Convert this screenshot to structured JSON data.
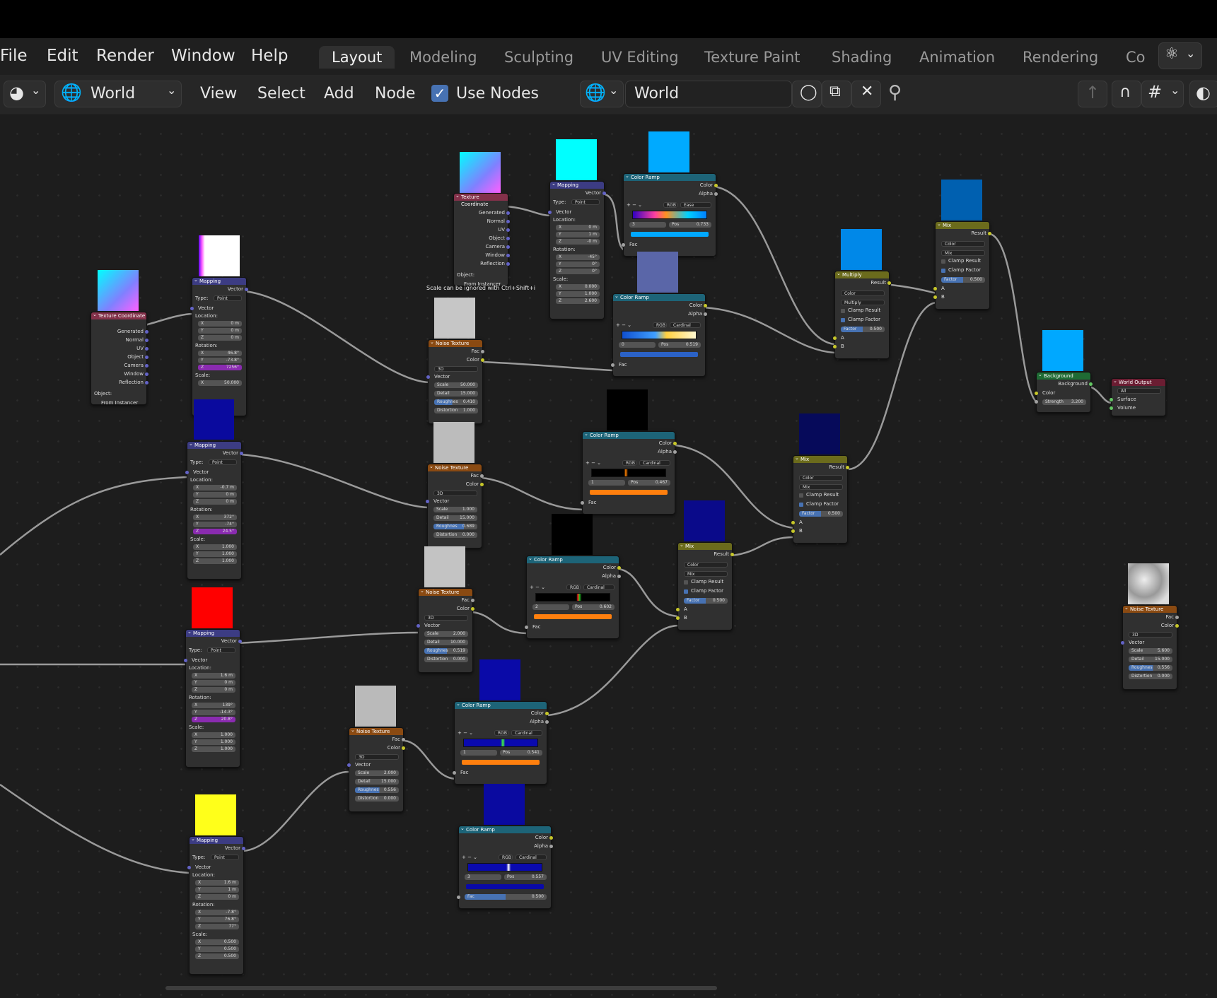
{
  "menu": {
    "file": "File",
    "edit": "Edit",
    "render": "Render",
    "window": "Window",
    "help": "Help"
  },
  "workspaces": [
    "Layout",
    "Modeling",
    "Sculpting",
    "UV Editing",
    "Texture Paint",
    "Shading",
    "Animation",
    "Rendering",
    "Co"
  ],
  "header": {
    "context": "World",
    "view": "View",
    "select": "Select",
    "add": "Add",
    "node": "Node",
    "use_nodes": "Use Nodes",
    "datablock": "World"
  },
  "hint": "Scale can be ignored with Ctrl+Shift+i",
  "labels": {
    "texcoord": "Texture Coordinate",
    "mapping": "Mapping",
    "noise": "Noise Texture",
    "ramp": "Color Ramp",
    "mix": "Mix",
    "multiply": "Multiply",
    "background": "Background",
    "world_output": "World Output",
    "generated": "Generated",
    "normal": "Normal",
    "uv": "UV",
    "object": "Object",
    "camera": "Camera",
    "window": "Window",
    "reflection": "Reflection",
    "object_field": "Object:",
    "from_instancer": "From Instancer",
    "vector": "Vector",
    "type": "Type:",
    "point": "Point",
    "location": "Location:",
    "rotation": "Rotation:",
    "scale": "Scale:",
    "fac": "Fac",
    "color": "Color",
    "alpha": "Alpha",
    "dim": "3D",
    "scale_f": "Scale",
    "detail": "Detail",
    "roughness": "Roughnes",
    "distortion": "Distortion",
    "rgb": "RGB",
    "pos": "Pos",
    "result": "Result",
    "mix_mode": "Mix",
    "multiply_mode": "Multiply",
    "clamp_result": "Clamp Result",
    "clamp_factor": "Clamp Factor",
    "factor": "Factor",
    "bg_out": "Background",
    "strength": "Strength",
    "all": "All",
    "surface": "Surface",
    "volume": "Volume",
    "a": "A",
    "b": "B"
  },
  "nodes": {
    "map1": {
      "loc": [
        "0 m",
        "0 m",
        "0 m"
      ],
      "rot": [
        "46.8°",
        "-73.8°",
        "7256°"
      ],
      "scale": [
        "50.000",
        "",
        ""
      ]
    },
    "map2": {
      "loc": [
        "-0.7 m",
        "0 m",
        "0 m"
      ],
      "rot": [
        "372°",
        "-74°",
        "24.5°"
      ],
      "scale": [
        "1.000",
        "1.000",
        "1.000"
      ]
    },
    "map3": {
      "loc": [
        "1.6 m",
        "0 m",
        "0 m"
      ],
      "rot": [
        "139°",
        "-14.3°",
        "20.8°"
      ],
      "scale": [
        "1.000",
        "1.000",
        "1.000"
      ]
    },
    "map4": {
      "loc": [
        "1.6 m",
        "1 m",
        "0 m"
      ],
      "rot": [
        "-7.8°",
        "76.8°",
        "77°"
      ],
      "scale": [
        "0.500",
        "0.500",
        "0.500"
      ]
    },
    "map5": {
      "loc": [
        "0 m",
        "1 m",
        "-0 m"
      ],
      "rot": [
        "-45°",
        "0°",
        "0°"
      ],
      "scale": [
        "0.000",
        "1.000",
        "2.600"
      ]
    },
    "noise1": {
      "scale": "50.000",
      "detail": "15.000",
      "rough": "0.410",
      "dist": "1.000"
    },
    "noise2": {
      "scale": "1.000",
      "detail": "15.000",
      "rough": "0.689",
      "dist": "0.000"
    },
    "noise3": {
      "scale": "2.000",
      "detail": "10.000",
      "rough": "0.519",
      "dist": "0.000"
    },
    "noise4": {
      "scale": "2.000",
      "detail": "15.000",
      "rough": "0.556",
      "dist": "0.000"
    },
    "noise5": {
      "scale": "5.600",
      "detail": "15.000",
      "rough": "0.556",
      "dist": "0.000"
    },
    "ramp1": {
      "interp": "Ease",
      "idx": "3",
      "pos": "0.733"
    },
    "ramp2": {
      "interp": "Cardinal",
      "idx": "0",
      "pos": "0.519"
    },
    "ramp3": {
      "interp": "Cardinal",
      "idx": "1",
      "pos": "0.467"
    },
    "ramp4": {
      "interp": "Cardinal",
      "idx": "2",
      "pos": "0.602"
    },
    "ramp5": {
      "interp": "Cardinal",
      "idx": "1",
      "pos": "0.541"
    },
    "ramp6": {
      "interp": "Cardinal",
      "idx": "3",
      "pos": "0.557",
      "fac": "0.500"
    },
    "mix_factor": "0.500",
    "bg_strength": "3.200"
  },
  "colors": {
    "accent": "#4772b3",
    "topbar": "#000000"
  }
}
